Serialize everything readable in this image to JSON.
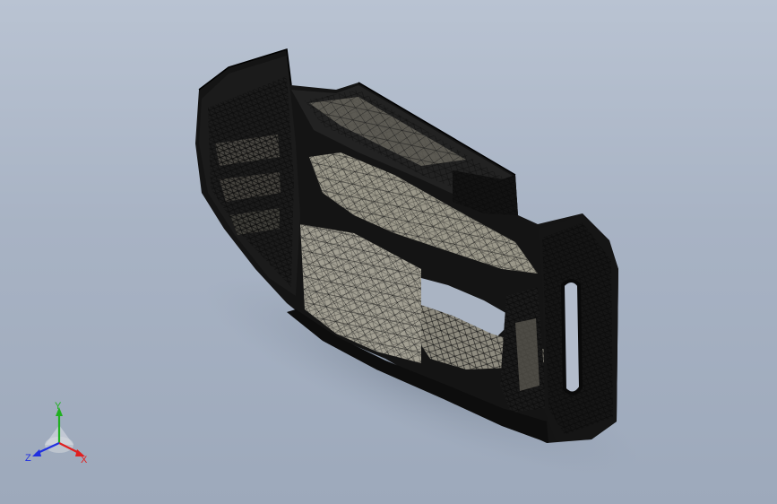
{
  "viewport": {
    "background_top": "#b9c3d2",
    "background_bottom": "#9da9bb",
    "model": {
      "mesh_color": "#0e0e0e",
      "face_color": "#9b988a",
      "shadow_color": "#7f8a9a"
    }
  },
  "triad": {
    "x_label": "X",
    "y_label": "Y",
    "z_label": "Z",
    "x_color": "#e02020",
    "y_color": "#20b020",
    "z_color": "#2030e0"
  }
}
